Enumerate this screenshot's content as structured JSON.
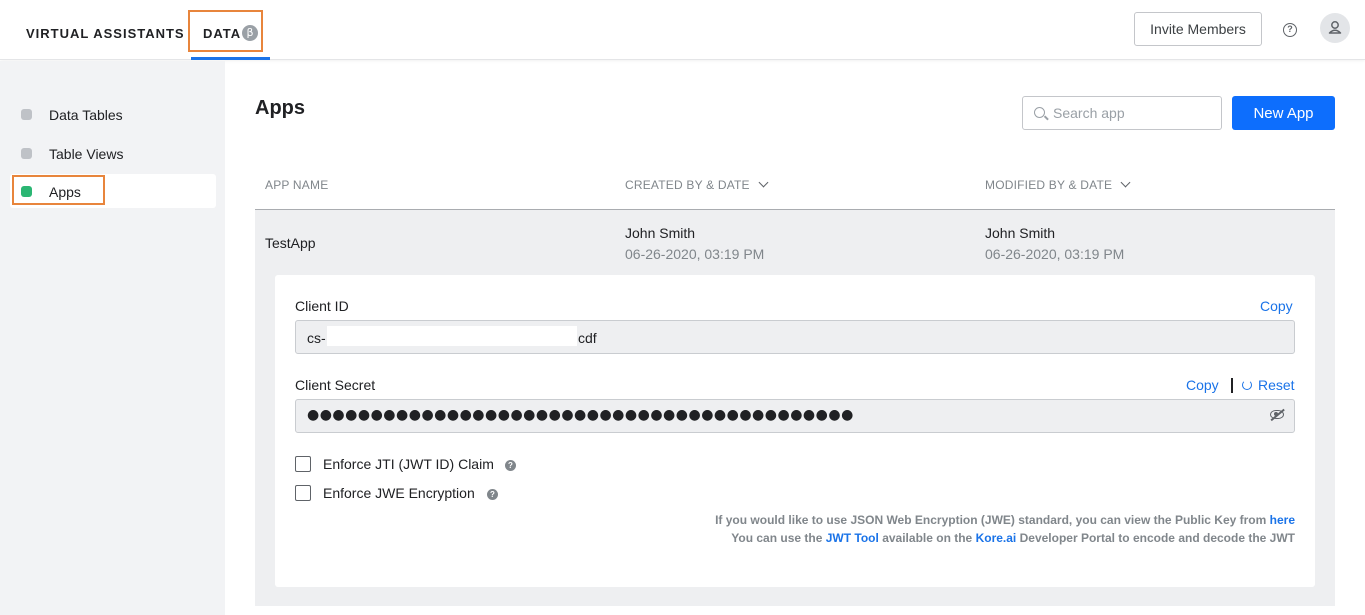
{
  "topnav": {
    "virtual_assistants": "VIRTUAL ASSISTANTS",
    "data": "DATA",
    "beta_badge": "β",
    "invite_members": "Invite Members",
    "help_icon": "help-circle-icon",
    "avatar_icon": "user-icon"
  },
  "sidebar": {
    "items": [
      {
        "label": "Data Tables",
        "active": false
      },
      {
        "label": "Table Views",
        "active": false
      },
      {
        "label": "Apps",
        "active": true
      }
    ]
  },
  "main": {
    "title": "Apps",
    "search_placeholder": "Search app",
    "new_app": "New App",
    "columns": [
      "APP NAME",
      "CREATED BY & DATE",
      "MODIFIED BY & DATE"
    ],
    "rows": [
      {
        "app_name": "TestApp",
        "created_by": "John Smith",
        "created_date": "06-26-2020, 03:19 PM",
        "modified_by": "John Smith",
        "modified_date": "06-26-2020, 03:19 PM"
      }
    ]
  },
  "details": {
    "client_id_label": "Client ID",
    "client_id_prefix": "cs-",
    "client_id_suffix": "cdf",
    "copy": "Copy",
    "client_secret_label": "Client Secret",
    "reset": "Reset",
    "client_secret_masked": "●●●●●●●●●●●●●●●●●●●●●●●●●●●●●●●●●●●●●●●●●●●",
    "enforce_jti": "Enforce JTI (JWT ID) Claim",
    "enforce_jwe": "Enforce JWE Encryption",
    "info_line1_text": "If you would like to use JSON Web Encryption (JWE) standard, you can view the Public Key from",
    "info_line1_link": "here",
    "info_line2_a": "You can use the",
    "info_line2_link1": "JWT Tool",
    "info_line2_b": "available on the",
    "info_line2_link2": "Kore.ai",
    "info_line2_c": "Developer Portal to encode and decode the JWT"
  },
  "colors": {
    "accent": "#0d6efd",
    "link": "#1a73e8",
    "active_dot": "#2bb673",
    "highlight_box": "#e8853c"
  }
}
